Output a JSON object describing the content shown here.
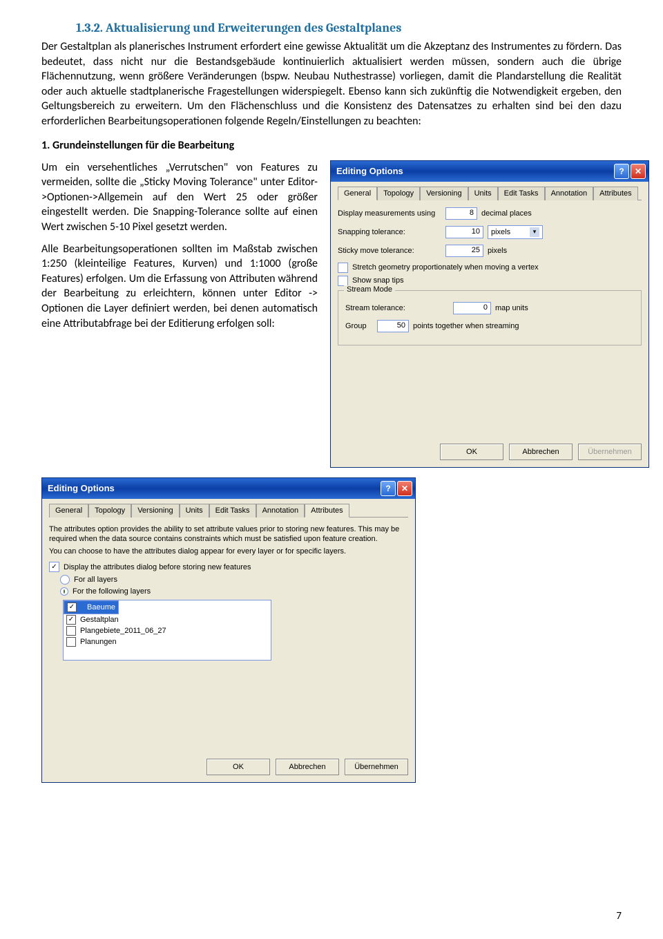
{
  "heading": "1.3.2.   Aktualisierung und Erweiterungen des Gestaltplanes",
  "para1": "Der Gestaltplan als planerisches Instrument erfordert eine gewisse Aktualität um die Akzeptanz des Instrumentes zu fördern. Das bedeutet, dass nicht nur die Bestandsgebäude kontinuierlich aktualisiert werden müssen, sondern auch die übrige Flächennutzung, wenn größere Veränderungen (bspw. Neubau Nuthestrasse) vorliegen, damit die Plandarstellung die Realität oder auch aktuelle stadtplanerische Fragestellungen widerspiegelt. Ebenso kann sich zukünftig die Notwendigkeit ergeben, den Geltungsbereich zu erweitern. Um den Flächenschluss und die Konsistenz des Datensatzes zu erhalten sind bei den dazu erforderlichen Bearbeitungsoperationen folgende Regeln/Einstellungen zu beachten:",
  "subhead": "1. Grundeinstellungen für die Bearbeitung",
  "left_p1": "Um ein versehentliches „Verrutschen\" von Features zu vermeiden, sollte die „Sticky Moving Tolerance\" unter Editor->Optionen->Allgemein auf den Wert 25 oder größer eingestellt werden. Die Snapping-Tolerance sollte auf einen Wert zwischen 5-10 Pixel gesetzt werden.",
  "left_p2": "Alle Bearbeitungsoperationen sollten im Maßstab zwischen 1:250 (kleinteilige Features, Kurven) und 1:1000 (große Features) erfolgen. Um die Erfassung von Attributen während der Bearbeitung zu erleichtern, können unter Editor -> Optionen die Layer definiert werden, bei denen automatisch eine Attributabfrage bei der Editierung erfolgen soll:",
  "dialog1": {
    "title": "Editing Options",
    "tabs": [
      "General",
      "Topology",
      "Versioning",
      "Units",
      "Edit Tasks",
      "Annotation",
      "Attributes"
    ],
    "active_tab": 0,
    "display_meas_label": "Display measurements using",
    "display_meas_value": "8",
    "display_meas_unit": "decimal places",
    "snap_tol_label": "Snapping tolerance:",
    "snap_tol_value": "10",
    "snap_tol_unit": "pixels",
    "sticky_label": "Sticky move tolerance:",
    "sticky_value": "25",
    "sticky_unit": "pixels",
    "chk_stretch": "Stretch geometry proportionately when moving a vertex",
    "chk_snap_tips": "Show snap tips",
    "stream_legend": "Stream Mode",
    "stream_tol_label": "Stream tolerance:",
    "stream_tol_value": "0",
    "stream_tol_unit": "map units",
    "group_label": "Group",
    "group_value": "50",
    "group_suffix": "points together when streaming",
    "ok": "OK",
    "cancel": "Abbrechen",
    "apply": "Übernehmen"
  },
  "dialog2": {
    "title": "Editing Options",
    "tabs": [
      "General",
      "Topology",
      "Versioning",
      "Units",
      "Edit Tasks",
      "Annotation",
      "Attributes"
    ],
    "active_tab": 6,
    "note1": "The attributes option provides the ability to set attribute values prior to storing new features. This may be required when the data source contains constraints which must be satisfied upon feature creation.",
    "note2": "You can choose to have the attributes dialog appear for every layer or for specific layers.",
    "chk_display": "Display the attributes dialog before storing new features",
    "radio_all": "For all layers",
    "radio_following": "For the following layers",
    "layers": [
      {
        "label": "Baeume",
        "checked": true,
        "selected": true
      },
      {
        "label": "Gestaltplan",
        "checked": true,
        "selected": false
      },
      {
        "label": "Plangebiete_2011_06_27",
        "checked": false,
        "selected": false
      },
      {
        "label": "Planungen",
        "checked": false,
        "selected": false
      }
    ],
    "ok": "OK",
    "cancel": "Abbrechen",
    "apply": "Übernehmen"
  },
  "pagenum": "7"
}
